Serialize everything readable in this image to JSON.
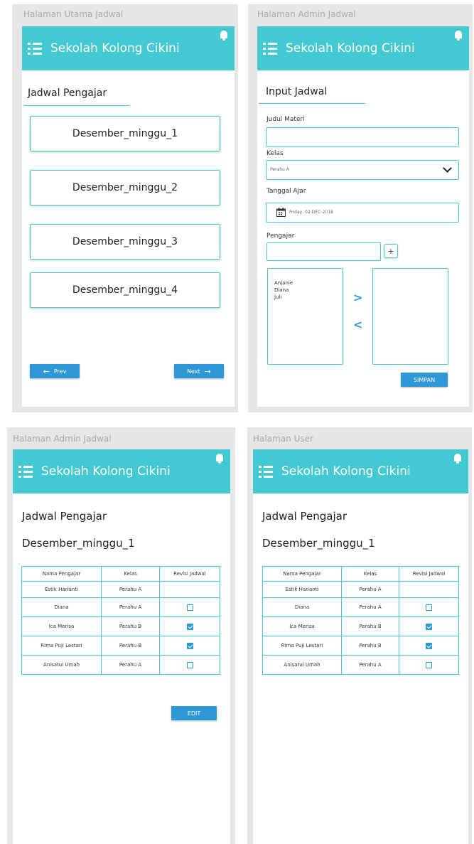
{
  "captions": {
    "home": "Halaman Utama Jadwal",
    "admin_input": "Halaman Admin Jadwal",
    "admin_table": "Halaman Admin Jadwal",
    "user": "Halaman User"
  },
  "app": {
    "title": "Sekolah Kolong Cikini"
  },
  "home": {
    "section_title": "Jadwal Pengajar",
    "weeks": [
      "Desember_minggu_1",
      "Desember_minggu_2",
      "Desember_minggu_3",
      "Desember_minggu_4"
    ],
    "prev_label": "Prev",
    "next_label": "Next"
  },
  "input_form": {
    "section_title": "Input Jadwal",
    "judul_label": "Judul Materi",
    "judul_value": "",
    "kelas_label": "Kelas",
    "kelas_selected": "Perahu A",
    "tanggal_label": "Tanggal Ajar",
    "tanggal_value": "Friday, 02-DEC-2018",
    "pengajar_label": "Pengajar",
    "pengajar_value": "",
    "add_label": "+",
    "available": [
      "Anjanie",
      "Diana",
      "Juli"
    ],
    "move_right": ">",
    "move_left": "<",
    "save_label": "SIMPAN"
  },
  "schedule": {
    "section_title": "Jadwal Pengajar",
    "week_title": "Desember_minggu_1",
    "columns": [
      "Nama Pengajar",
      "Kelas",
      "Revisi Jadwal"
    ],
    "rows": [
      {
        "name": "Estik Harianti",
        "kelas": "Perahu A",
        "revisi": null
      },
      {
        "name": "Diana",
        "kelas": "Perahu A",
        "revisi": false
      },
      {
        "name": "Ica Merisa",
        "kelas": "Perahu B",
        "revisi": true
      },
      {
        "name": "Rima Puji Lestari",
        "kelas": "Perahu B",
        "revisi": true
      },
      {
        "name": "Anisatul Umah",
        "kelas": "Perahu A",
        "revisi": false
      }
    ],
    "edit_label": "EDIT"
  },
  "colors": {
    "primary": "#43c9d1",
    "button": "#2e98d6",
    "caption": "#a9a9a9"
  },
  "icons": {
    "menu": "menu-list-icon",
    "bell": "bell-icon",
    "calendar": "calendar-icon",
    "arrow_left": "arrow-left-icon",
    "arrow_right": "arrow-right-icon",
    "dropdown": "chevron-down-icon"
  }
}
